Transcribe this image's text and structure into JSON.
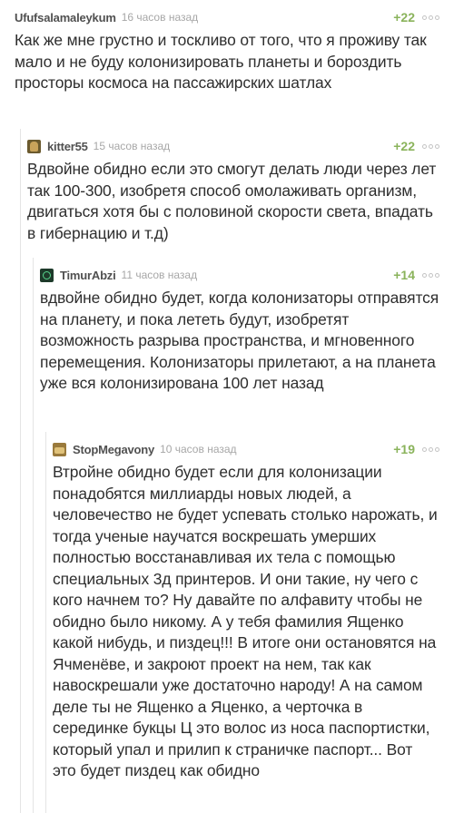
{
  "comments": [
    {
      "username": "Ufufsalamaleykum",
      "timestamp": "16 часов назад",
      "rating": "+22",
      "avatar": "none",
      "text": "Как же мне грустно и тоскливо от того, что я проживу так мало и не буду колонизировать планеты и бороздить просторы космоса на пассажирских шатлах"
    },
    {
      "username": "kitter55",
      "timestamp": "15 часов назад",
      "rating": "+22",
      "avatar": "avatar-icon",
      "text": "Вдвойне обидно если это смогут делать люди через лет так 100-300, изобретя способ омолаживать организм, двигаться хотя бы с половиной скорости света, впадать в гибернацию и т.д)"
    },
    {
      "username": "TimurAbzi",
      "timestamp": "11 часов назад",
      "rating": "+14",
      "avatar": "avatar-icon",
      "text": "вдвойне  обидно будет, когда колонизаторы отправятся на планету, и пока лететь будут, изобретят возможность разрыва пространства, и мгновенного перемещения. Колонизаторы прилетают, а на планета уже вся колонизирована 100 лет назад"
    },
    {
      "username": "StopMegavony",
      "timestamp": "10 часов назад",
      "rating": "+19",
      "avatar": "avatar-icon",
      "text": "Втройне  обидно будет если для колонизации понадобятся миллиарды новых людей, а человечество не будет успевать столько нарожать, и тогда ученые научатся воскрешать умерших полностью восстанавливая их тела с помощью специальных 3д принтеров. И они такие, ну чего с кого начнем то? Ну давайте по алфавиту чтобы не обидно было никому. А у тебя фамилия Ященко какой нибудь, и пиздец!!! В итоге они остановятся на Ячменёве, и закроют проект на нем, так как навоскрешали уже достаточно народу! А на самом деле ты не Ященко а Яценко, а черточка в серединке букцы Ц это волос из носа паспортистки, который упал и прилип к страничке паспорт... Вот это будет пиздец как обидно"
    }
  ],
  "colors": {
    "rating": "#8ab35b",
    "username": "#505050",
    "timestamp": "#a7a7a7",
    "text": "#2e2e2e",
    "thread_line": "#e4e4e4"
  },
  "icons": {
    "more": "more-options-icon"
  }
}
